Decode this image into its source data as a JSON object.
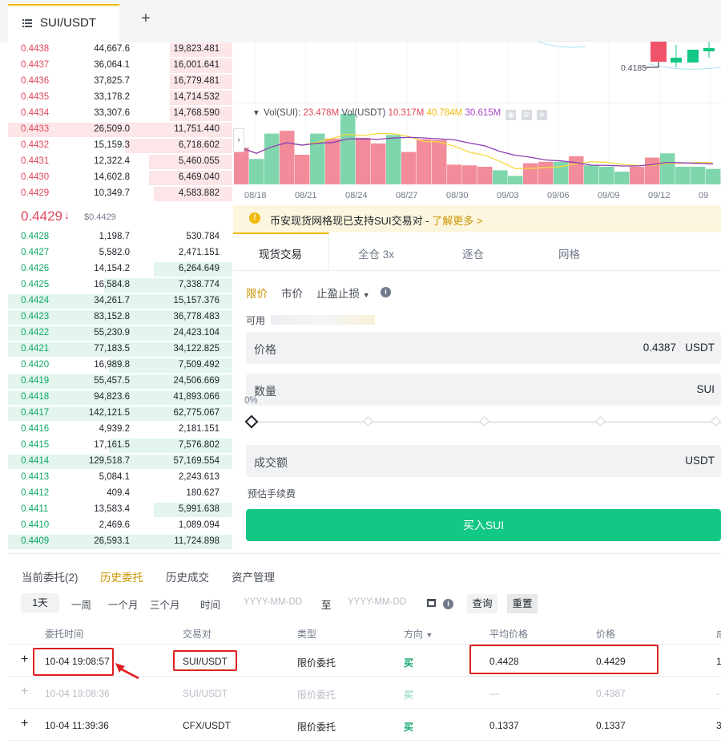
{
  "tab": {
    "symbol": "SUI/USDT",
    "add_label": "+"
  },
  "orderbook": {
    "asks": [
      {
        "price": "0.4438",
        "amount": "44,667.6",
        "total": "19,823.481",
        "depth": 0.28
      },
      {
        "price": "0.4437",
        "amount": "36,064.1",
        "total": "16,001.641",
        "depth": 0.28
      },
      {
        "price": "0.4436",
        "amount": "37,825.7",
        "total": "16,779.481",
        "depth": 0.28
      },
      {
        "price": "0.4435",
        "amount": "33,178.2",
        "total": "14,714.532",
        "depth": 0.28
      },
      {
        "price": "0.4434",
        "amount": "33,307.6",
        "total": "14,768.590",
        "depth": 0.28
      },
      {
        "price": "0.4433",
        "amount": "26,509.0",
        "total": "11,751.440",
        "depth": 1.0
      },
      {
        "price": "0.4432",
        "amount": "15,159.3",
        "total": "6,718.602",
        "depth": 0.48
      },
      {
        "price": "0.4431",
        "amount": "12,322.4",
        "total": "5,460.055",
        "depth": 0.37
      },
      {
        "price": "0.4430",
        "amount": "14,602.8",
        "total": "6,469.040",
        "depth": 0.37
      },
      {
        "price": "0.4429",
        "amount": "10,349.7",
        "total": "4,583.882",
        "depth": 0.35
      }
    ],
    "last_price": "0.4429",
    "last_arrow": "↓",
    "last_usd": "$0.4429",
    "bids": [
      {
        "price": "0.4428",
        "amount": "1,198.7",
        "total": "530.784",
        "depth": 0.0
      },
      {
        "price": "0.4427",
        "amount": "5,582.0",
        "total": "2,471.151",
        "depth": 0.0
      },
      {
        "price": "0.4426",
        "amount": "14,154.2",
        "total": "6,264.649",
        "depth": 0.35
      },
      {
        "price": "0.4425",
        "amount": "16,584.8",
        "total": "7,338.774",
        "depth": 0.57
      },
      {
        "price": "0.4424",
        "amount": "34,261.7",
        "total": "15,157.376",
        "depth": 1.0
      },
      {
        "price": "0.4423",
        "amount": "83,152.8",
        "total": "36,778.483",
        "depth": 1.0
      },
      {
        "price": "0.4422",
        "amount": "55,230.9",
        "total": "24,423.104",
        "depth": 1.0
      },
      {
        "price": "0.4421",
        "amount": "77,183.5",
        "total": "34,122.825",
        "depth": 1.0
      },
      {
        "price": "0.4420",
        "amount": "16,989.8",
        "total": "7,509.492",
        "depth": 0.55
      },
      {
        "price": "0.4419",
        "amount": "55,457.5",
        "total": "24,506.669",
        "depth": 1.0
      },
      {
        "price": "0.4418",
        "amount": "94,823.6",
        "total": "41,893.066",
        "depth": 1.0
      },
      {
        "price": "0.4417",
        "amount": "142,121.5",
        "total": "62,775.067",
        "depth": 1.0
      },
      {
        "price": "0.4416",
        "amount": "4,939.2",
        "total": "2,181.151",
        "depth": 0.0
      },
      {
        "price": "0.4415",
        "amount": "17,161.5",
        "total": "7,576.802",
        "depth": 0.55
      },
      {
        "price": "0.4414",
        "amount": "129,518.7",
        "total": "57,169.554",
        "depth": 1.0
      },
      {
        "price": "0.4413",
        "amount": "5,084.1",
        "total": "2,243.613",
        "depth": 0.0
      },
      {
        "price": "0.4412",
        "amount": "409.4",
        "total": "180.627",
        "depth": 0.0
      },
      {
        "price": "0.4411",
        "amount": "13,583.4",
        "total": "5,991.638",
        "depth": 0.35
      },
      {
        "price": "0.4410",
        "amount": "2,469.6",
        "total": "1,089.094",
        "depth": 0.0
      },
      {
        "price": "0.4409",
        "amount": "26,593.1",
        "total": "11,724.898",
        "depth": 1.0
      }
    ]
  },
  "chart": {
    "price_tag": "0.4185",
    "vol_legend": {
      "label_sui": "Vol(SUI):",
      "value_sui": "23.478M",
      "label_usdt": "Vol(USDT)",
      "value_usdt": "10.317M",
      "ma1": "40.784M",
      "ma2": "30.615M"
    },
    "dates": [
      "08/18",
      "08/21",
      "08/24",
      "08/27",
      "08/30",
      "09/03",
      "09/06",
      "09/09",
      "09/12",
      "09"
    ],
    "volume_bars": [
      {
        "v": 0.52,
        "up": false
      },
      {
        "v": 0.36,
        "up": true
      },
      {
        "v": 0.72,
        "up": true
      },
      {
        "v": 0.76,
        "up": false
      },
      {
        "v": 0.42,
        "up": false
      },
      {
        "v": 0.72,
        "up": true
      },
      {
        "v": 0.65,
        "up": false
      },
      {
        "v": 1.0,
        "up": true
      },
      {
        "v": 0.66,
        "up": false
      },
      {
        "v": 0.58,
        "up": false
      },
      {
        "v": 0.7,
        "up": true
      },
      {
        "v": 0.46,
        "up": false
      },
      {
        "v": 0.64,
        "up": false
      },
      {
        "v": 0.63,
        "up": false
      },
      {
        "v": 0.28,
        "up": false
      },
      {
        "v": 0.27,
        "up": false
      },
      {
        "v": 0.25,
        "up": false
      },
      {
        "v": 0.2,
        "up": true
      },
      {
        "v": 0.12,
        "up": true
      },
      {
        "v": 0.3,
        "up": false
      },
      {
        "v": 0.32,
        "up": false
      },
      {
        "v": 0.32,
        "up": true
      },
      {
        "v": 0.4,
        "up": false
      },
      {
        "v": 0.27,
        "up": true
      },
      {
        "v": 0.25,
        "up": true
      },
      {
        "v": 0.18,
        "up": true
      },
      {
        "v": 0.25,
        "up": false
      },
      {
        "v": 0.38,
        "up": false
      },
      {
        "v": 0.44,
        "up": true
      },
      {
        "v": 0.25,
        "up": true
      },
      {
        "v": 0.25,
        "up": true
      },
      {
        "v": 0.22,
        "up": true
      }
    ],
    "colors": {
      "up": "#7fd6ac",
      "down": "#f28c9a",
      "ma1": "#f5d93c",
      "ma2": "#8b3fb5"
    }
  },
  "notice": {
    "text": "币安现货网格现已支持SUI交易对 - ",
    "link": "了解更多 >"
  },
  "trade_tabs": [
    "现货交易",
    "全仓 3x",
    "逐仓",
    "网格"
  ],
  "order_types": {
    "limit": "限价",
    "market": "市价",
    "stop": "止盈止损"
  },
  "form": {
    "available_label": "可用",
    "price_label": "价格",
    "price_value": "0.4387",
    "price_unit": "USDT",
    "qty_label": "数量",
    "qty_unit": "SUI",
    "slider_pct": "0%",
    "total_label": "成交额",
    "total_unit": "USDT",
    "fee_label": "预估手续费",
    "buy_button": "买入SUI"
  },
  "bottom": {
    "tabs": [
      "当前委托(2)",
      "历史委托",
      "历史成交",
      "资产管理"
    ],
    "ranges": [
      "1天",
      "一周",
      "一个月",
      "三个月",
      "时间"
    ],
    "date_placeholder": "YYYY-MM-DD",
    "date_to": "至",
    "query": "查询",
    "reset": "重置",
    "headers": [
      "委托时间",
      "交易对",
      "类型",
      "方向",
      "平均价格",
      "价格"
    ],
    "rows": [
      {
        "time": "10-04 19:08:57",
        "pair": "SUI/USDT",
        "type": "限价委托",
        "side": "买",
        "avg": "0.4428",
        "price": "0.4429",
        "extra": "1"
      },
      {
        "time": "10-04 19:08:36",
        "pair": "SUI/USDT",
        "type": "限价委托",
        "side": "买",
        "avg": "—",
        "price": "0.4387",
        "extra": "-"
      },
      {
        "time": "10-04 11:39:36",
        "pair": "CFX/USDT",
        "type": "限价委托",
        "side": "买",
        "avg": "0.1337",
        "price": "0.1337",
        "extra": "3"
      }
    ]
  }
}
